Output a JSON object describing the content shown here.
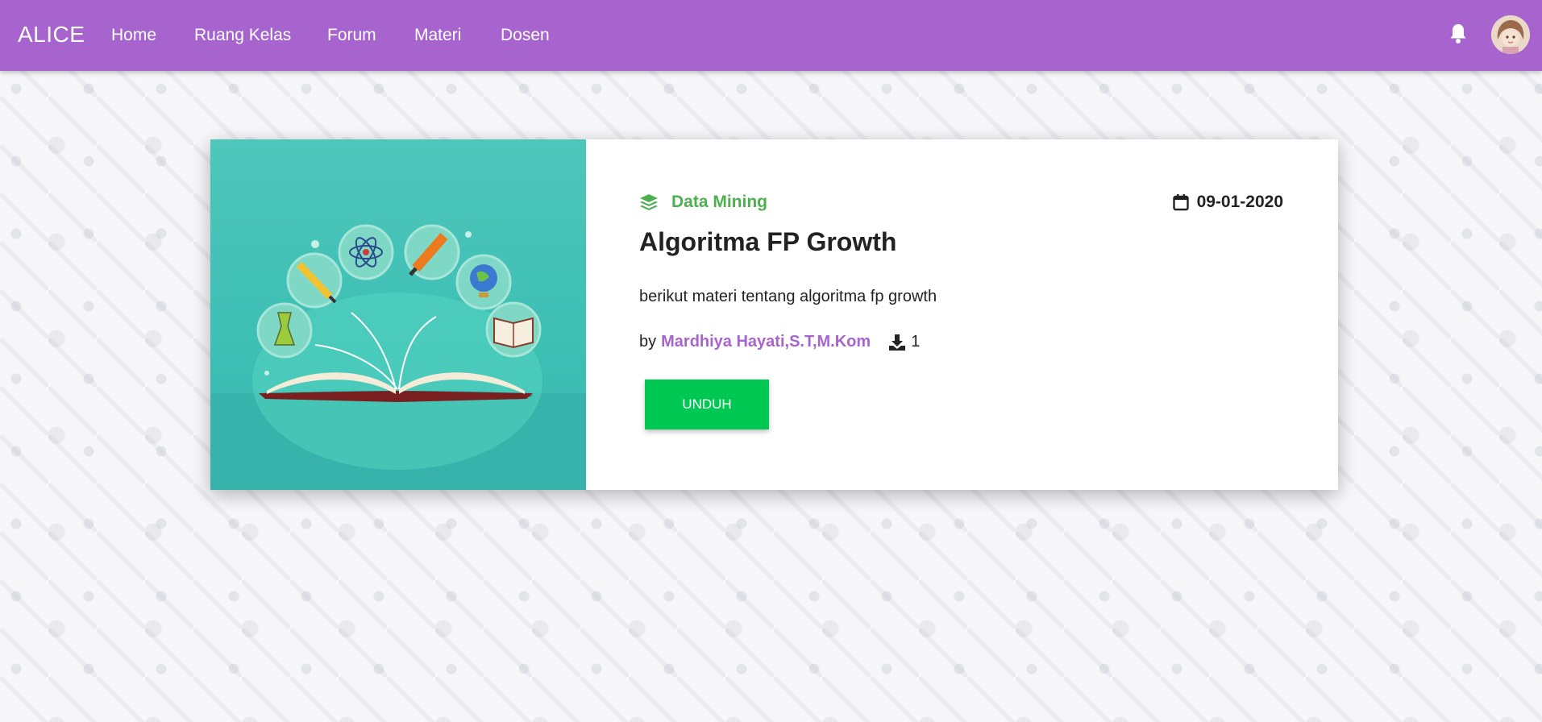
{
  "navbar": {
    "brand": "ALICE",
    "links": [
      "Home",
      "Ruang Kelas",
      "Forum",
      "Materi",
      "Dosen"
    ],
    "bell_icon": "bell-icon",
    "avatar": "user-avatar",
    "color": "#a764cf"
  },
  "card": {
    "category": "Data Mining",
    "category_icon": "layers-icon",
    "date": "09-01-2020",
    "date_icon": "calendar-icon",
    "title": "Algoritma FP Growth",
    "description": "berikut materi tentang algoritma fp growth",
    "by_label": "by",
    "author": "Mardhiya Hayati,S.T,M.Kom",
    "download_icon": "download-icon",
    "download_count": "1",
    "button_label": "UNDUH",
    "colors": {
      "category": "#4caf50",
      "author": "#a764cf",
      "button": "#00c853",
      "image_bg": "#47c3b8"
    }
  }
}
